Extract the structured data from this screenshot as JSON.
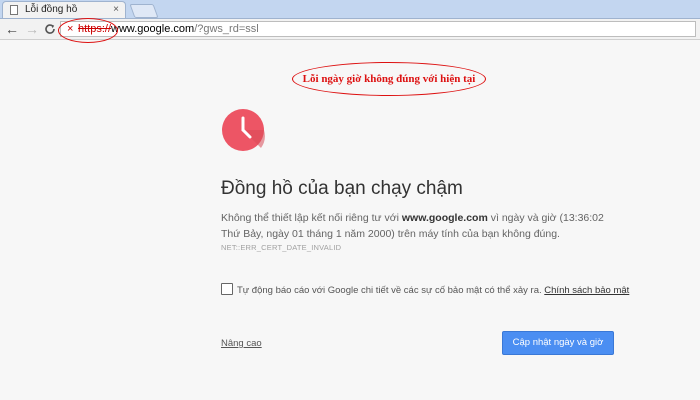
{
  "browser": {
    "tab": {
      "title": "Lỗi đồng hồ",
      "close_glyph": "×",
      "icon": "page-icon"
    },
    "toolbar": {
      "back_glyph": "←",
      "forward_glyph": "→",
      "reload_glyph": "C"
    },
    "omnibox": {
      "security_glyph": "×",
      "scheme": "https://",
      "host": "www.google.com",
      "path": "/?gws_rd=ssl"
    }
  },
  "annotation": {
    "text": "Lỗi ngày giờ không đúng với hiện tại",
    "color": "#dd1111"
  },
  "error_page": {
    "icon": "clock-icon",
    "icon_color": "#ed5565",
    "heading": "Đồng hồ của bạn chạy chậm",
    "description_before": "Không thể thiết lập kết nối riêng tư với ",
    "description_host": "www.google.com",
    "description_after": " vì ngày và giờ (13:36:02 Thứ Bảy, ngày 01 tháng 1 năm 2000) trên máy tính của bạn không đúng.",
    "error_code": "NET::ERR_CERT_DATE_INVALID",
    "report_checkbox_label": "Tự động báo cáo với Google chi tiết về các sự cố bảo mật có thể xảy ra.",
    "privacy_link": "Chính sách bảo mật",
    "advanced_link": "Nâng cao",
    "update_button": "Cập nhật ngày và giờ",
    "button_color": "#4b8ef2"
  }
}
